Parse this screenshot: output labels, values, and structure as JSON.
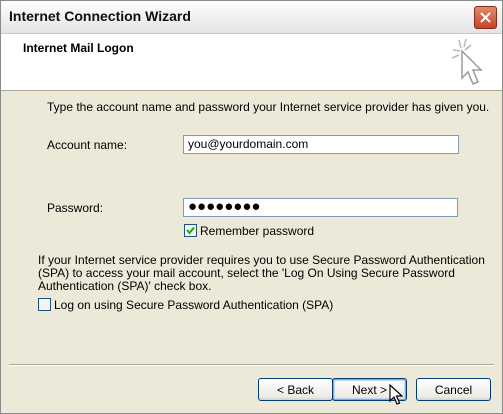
{
  "window": {
    "title": "Internet Connection Wizard"
  },
  "header": {
    "title": "Internet Mail Logon",
    "icon": "wizard-sparkle-icon"
  },
  "main": {
    "intro": "Type the account name and password your Internet service provider has given you.",
    "account_label": "Account name:",
    "account_value": "you@yourdomain.com",
    "password_label": "Password:",
    "password_value": "●●●●●●●●",
    "remember_label": "Remember password",
    "remember_checked": true,
    "spa_note_line1": "If your Internet service provider requires you to use Secure Password Authentication",
    "spa_note_line2": "(SPA) to access your mail account, select the 'Log On Using Secure Password",
    "spa_note_line3": "Authentication (SPA)' check box.",
    "spa_label": "Log on using Secure Password Authentication (SPA)",
    "spa_checked": false
  },
  "buttons": {
    "back": "< Back",
    "next": "Next >",
    "cancel": "Cancel"
  },
  "colors": {
    "close_button": "#c4452a",
    "input_border": "#7f9db9",
    "dialog_bg": "#ece9d8"
  }
}
